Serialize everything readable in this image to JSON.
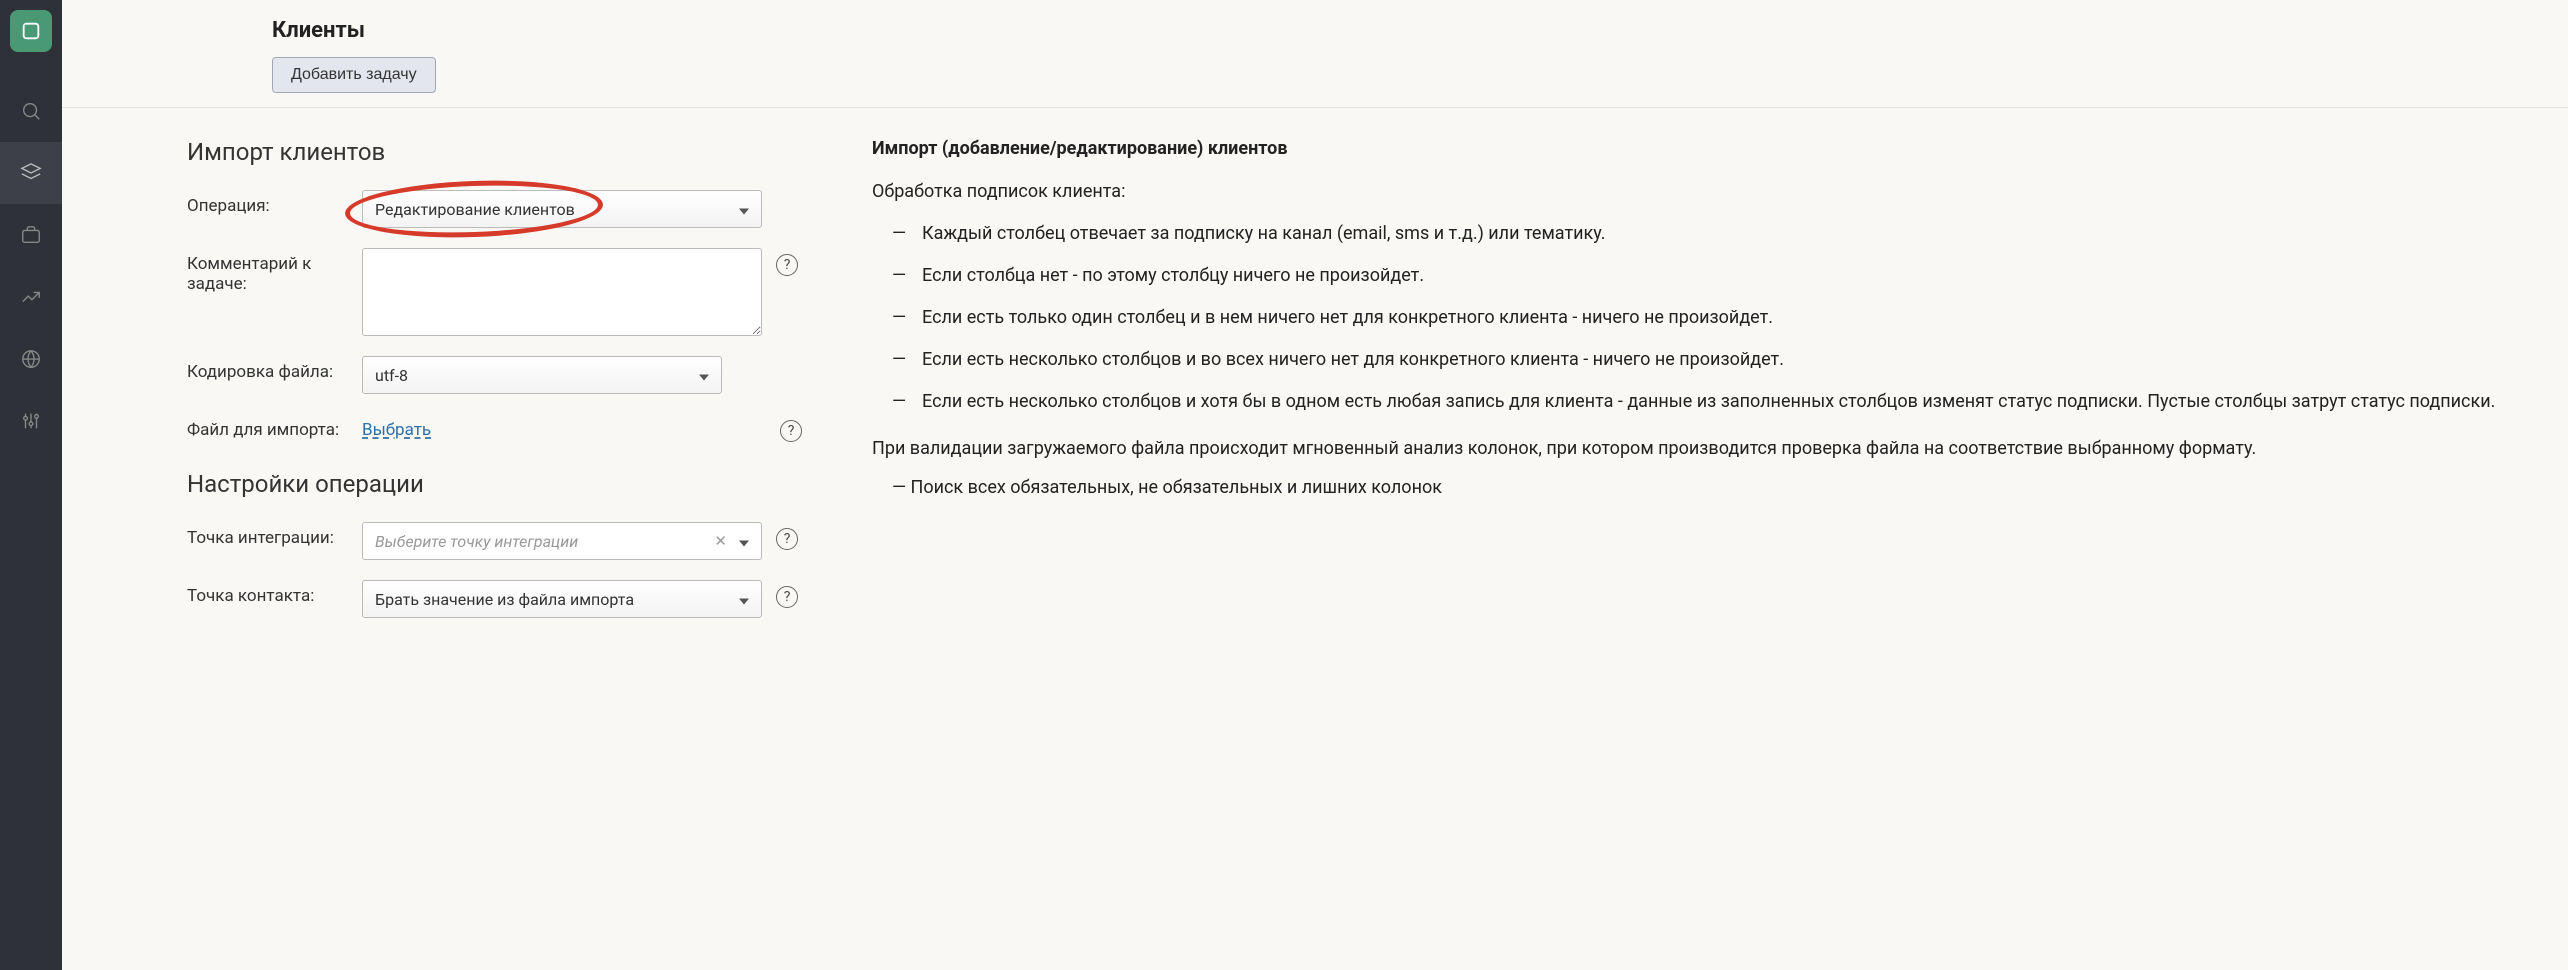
{
  "header": {
    "page_title": "Клиенты",
    "add_task_button": "Добавить задачу"
  },
  "form": {
    "section_import_title": "Импорт клиентов",
    "operation_label": "Операция:",
    "operation_value": "Редактирование клиентов",
    "comment_label": "Комментарий к задаче:",
    "encoding_label": "Кодировка файла:",
    "encoding_value": "utf-8",
    "file_label": "Файл для импорта:",
    "file_choose": "Выбрать",
    "section_settings_title": "Настройки операции",
    "integration_label": "Точка интеграции:",
    "integration_placeholder": "Выберите точку интеграции",
    "contact_point_label": "Точка контакта:",
    "contact_point_value": "Брать значение из файла импорта"
  },
  "info": {
    "title": "Импорт (добавление/редактирование) клиентов",
    "subscriptions_heading": "Обработка подписок клиента:",
    "bullets": [
      "Каждый столбец отвечает за подписку на канал (email, sms и т.д.) или тематику.",
      "Если столбца нет - по этому столбцу ничего не произойдет.",
      "Если есть только один столбец и в нем ничего нет для конкретного клиента - ничего не произойдет.",
      "Если есть несколько столбцов и во всех ничего нет для конкретного клиента - ничего не произойдет.",
      "Если есть несколько столбцов и хотя бы в одном есть любая запись для клиента - данные из заполненных столбцов изменят статус подписки. Пустые столбцы затрут статус подписки."
    ],
    "validation_para": "При валидации загружаемого файла происходит мгновенный анализ колонок, при котором производится проверка файла на соответствие выбранному формату.",
    "validation_dash": "—  Поиск всех обязательных, не обязательных и лишних колонок"
  },
  "help_glyph": "?"
}
